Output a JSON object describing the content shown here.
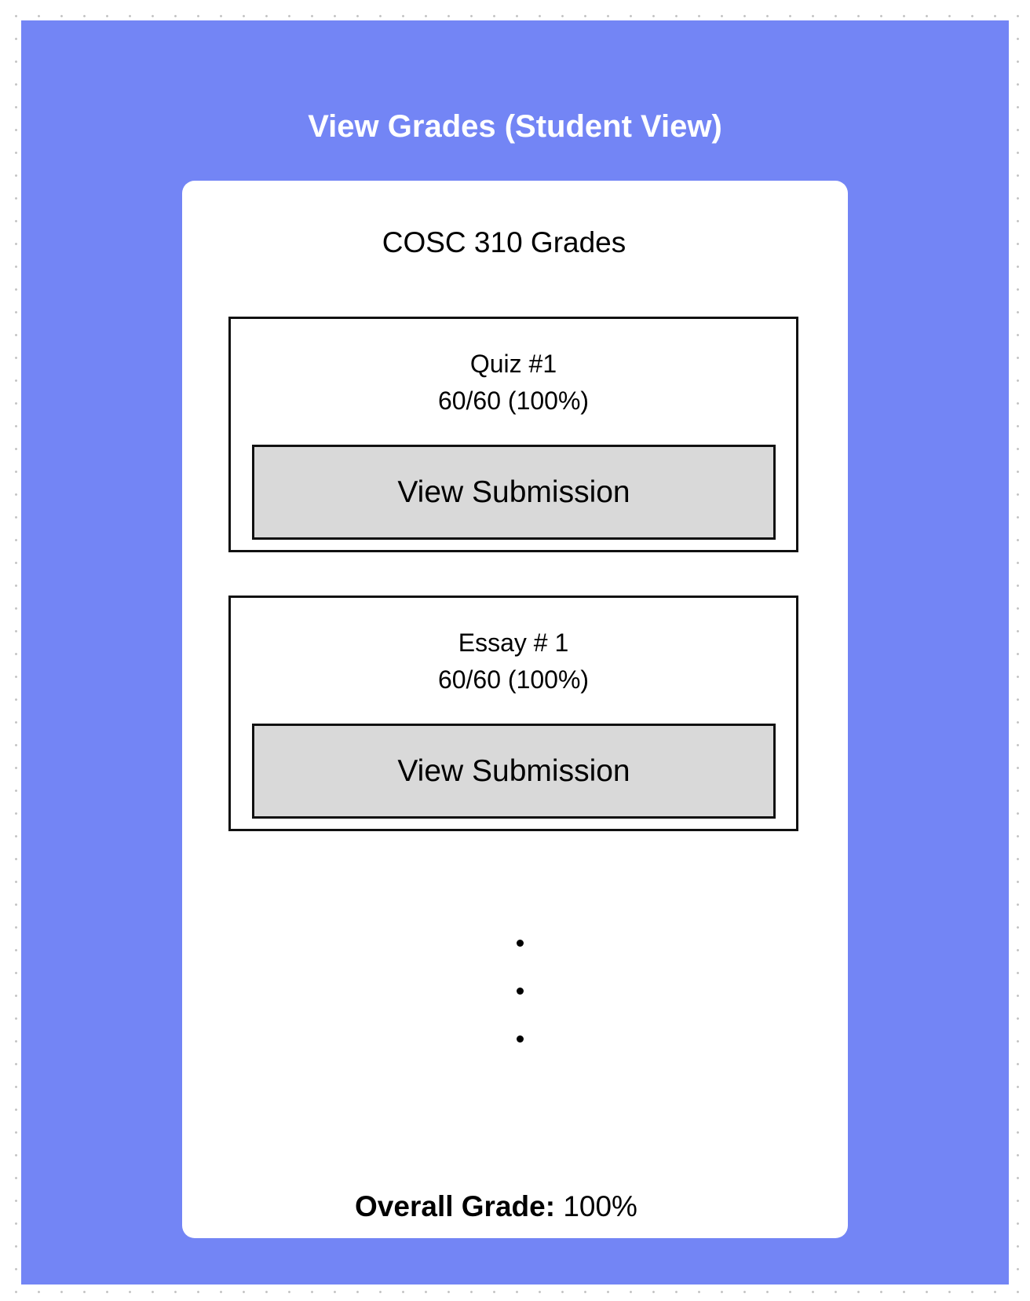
{
  "page": {
    "title": "View Grades (Student View)"
  },
  "card": {
    "title": "COSC 310 Grades",
    "items": [
      {
        "name": "Quiz #1",
        "score": "60/60 (100%)",
        "button_label": "View Submission"
      },
      {
        "name": "Essay # 1",
        "score": "60/60 (100%)",
        "button_label": "View Submission"
      }
    ],
    "more_indicator": "ellipsis-vertical-icon",
    "overall": {
      "label": "Overall Grade:",
      "value": "100%"
    }
  },
  "colors": {
    "frame_background": "#7385f5",
    "card_background": "#ffffff",
    "button_background": "#d9d9d9",
    "title_text": "#ffffff"
  }
}
